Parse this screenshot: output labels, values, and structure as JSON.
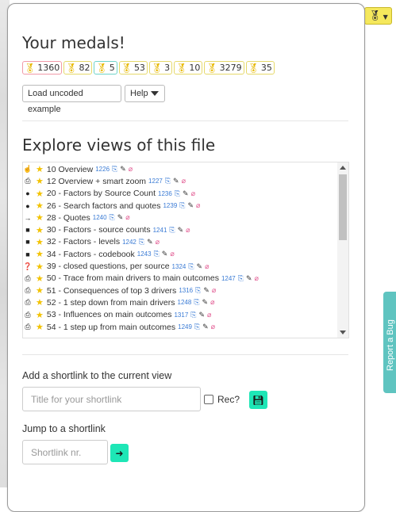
{
  "medals_section": {
    "title": "Your medals!",
    "medals": [
      {
        "value": "1360",
        "style": "pink"
      },
      {
        "value": "82",
        "style": "gold"
      },
      {
        "value": "5",
        "style": "teal"
      },
      {
        "value": "53",
        "style": "gold"
      },
      {
        "value": "3",
        "style": "gold"
      },
      {
        "value": "10",
        "style": "gold"
      },
      {
        "value": "3279",
        "style": "gold"
      },
      {
        "value": "35",
        "style": "gold"
      }
    ],
    "medal_icon": "medal-icon"
  },
  "buttons": {
    "load_example": "Load uncoded example",
    "help": "Help"
  },
  "views_section": {
    "title": "Explore views of this file",
    "items": [
      {
        "icon": "pointer",
        "label": "10 Overview",
        "num": "1226"
      },
      {
        "icon": "print",
        "label": "12 Overview + smart zoom",
        "num": "1227"
      },
      {
        "icon": "comment",
        "label": "20 - Factors by Source Count",
        "num": "1236"
      },
      {
        "icon": "comment",
        "label": "26 - Search factors and quotes",
        "num": "1239"
      },
      {
        "icon": "arrow-right",
        "label": "28 - Quotes",
        "num": "1240"
      },
      {
        "icon": "square",
        "label": "30 - Factors - source counts",
        "num": "1241"
      },
      {
        "icon": "square",
        "label": "32 - Factors - levels",
        "num": "1242"
      },
      {
        "icon": "square",
        "label": "34 - Factors - codebook",
        "num": "1243"
      },
      {
        "icon": "question",
        "label": "39 - closed questions, per source",
        "num": "1324"
      },
      {
        "icon": "print",
        "label": "50 - Trace from main drivers to main outcomes",
        "num": "1247"
      },
      {
        "icon": "print",
        "label": "51 - Consequences of top 3 drivers",
        "num": "1316"
      },
      {
        "icon": "print",
        "label": "52 - 1 step down from main drivers",
        "num": "1248"
      },
      {
        "icon": "print",
        "label": "53 - Influences on main outcomes",
        "num": "1317"
      },
      {
        "icon": "print",
        "label": "54 - 1 step up from main outcomes",
        "num": "1249"
      }
    ]
  },
  "shortlink_add": {
    "label": "Add a shortlink to the current view",
    "placeholder": "Title for your shortlink",
    "rec_label": "Rec?"
  },
  "shortlink_jump": {
    "label": "Jump to a shortlink",
    "placeholder": "Shortlink nr."
  },
  "side_tab": {
    "text": "Report a Bug"
  },
  "colors": {
    "accent_green": "#1ee6b6",
    "medal_gold": "#e7b800",
    "star": "#f2c200",
    "link_blue": "#3a7bd5",
    "hide_pink": "#e0518c",
    "side_tab": "#5fc4c0",
    "toggle_yellow": "#f5e85c"
  }
}
